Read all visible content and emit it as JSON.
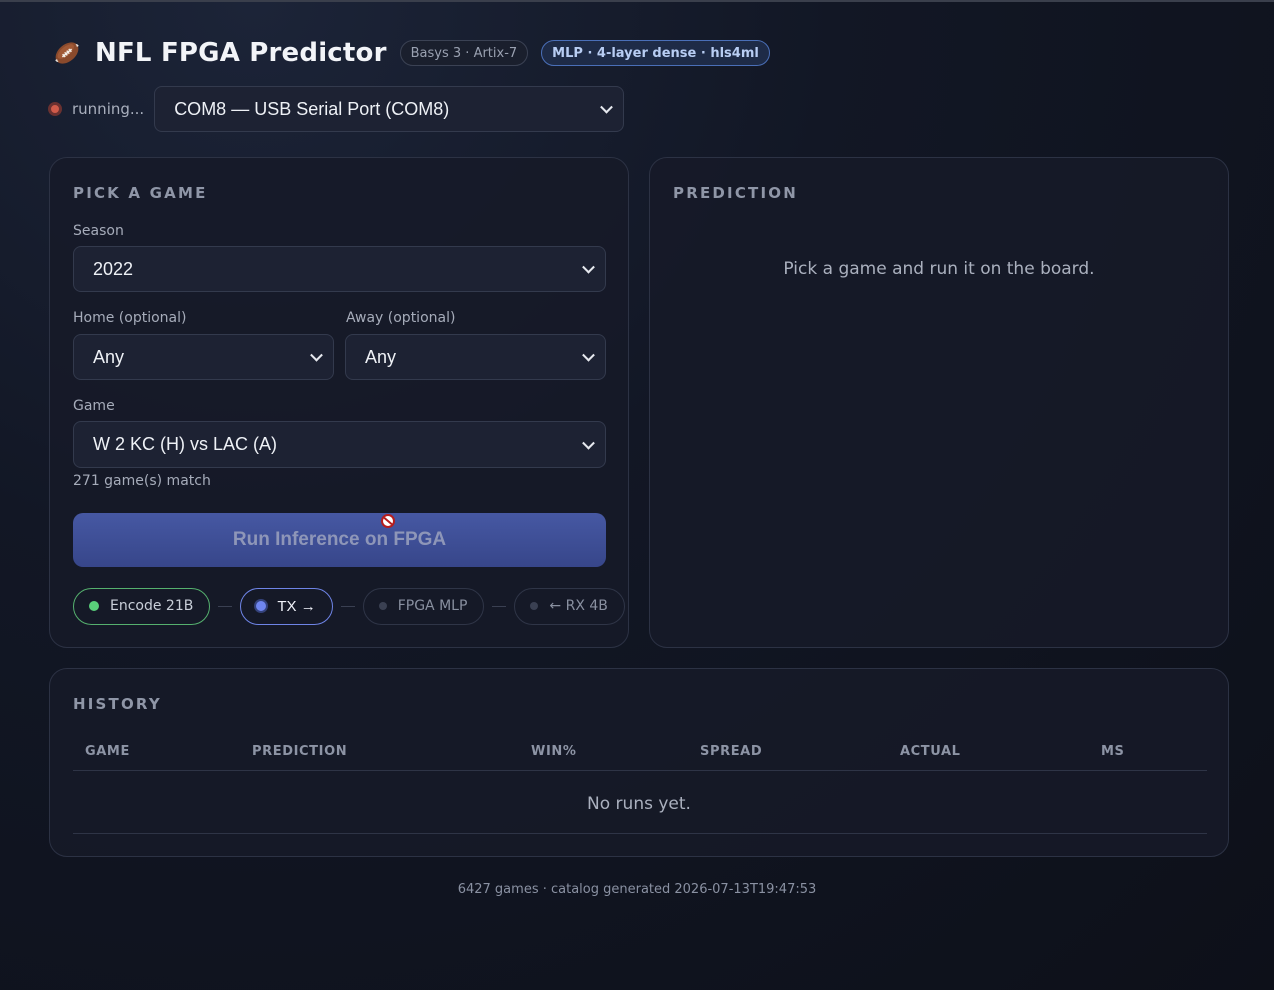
{
  "header": {
    "title": "NFL FPGA Predictor",
    "board_badge": "Basys 3 · Artix-7",
    "model_badge": "MLP · 4-layer dense · hls4ml"
  },
  "status": {
    "text": "running...",
    "port_selected": "COM8 — USB Serial Port (COM8)",
    "status_color": "#d05b4a"
  },
  "pick": {
    "title": "PICK A GAME",
    "season_label": "Season",
    "season_value": "2022",
    "home_label": "Home (optional)",
    "home_value": "Any",
    "away_label": "Away (optional)",
    "away_value": "Any",
    "game_label": "Game",
    "game_value": "W 2 KC (H) vs LAC (A)",
    "match_count": "271 game(s) match",
    "run_button": "Run Inference on FPGA",
    "pipeline": [
      {
        "label": "Encode 21B",
        "state": "done"
      },
      {
        "label": "TX →",
        "state": "active"
      },
      {
        "label": "FPGA MLP",
        "state": "pending"
      },
      {
        "label": "← RX 4B",
        "state": "pending"
      }
    ]
  },
  "prediction": {
    "title": "PREDICTION",
    "empty_text": "Pick a game and run it on the board."
  },
  "history": {
    "title": "HISTORY",
    "columns": [
      "GAME",
      "PREDICTION",
      "WIN%",
      "SPREAD",
      "ACTUAL",
      "MS"
    ],
    "empty_text": "No runs yet."
  },
  "footer": "6427 games · catalog generated 2026-07-13T19:47:53",
  "colors": {
    "accent": "#4658a3",
    "done": "#59d07a",
    "active": "#6f86f0"
  }
}
